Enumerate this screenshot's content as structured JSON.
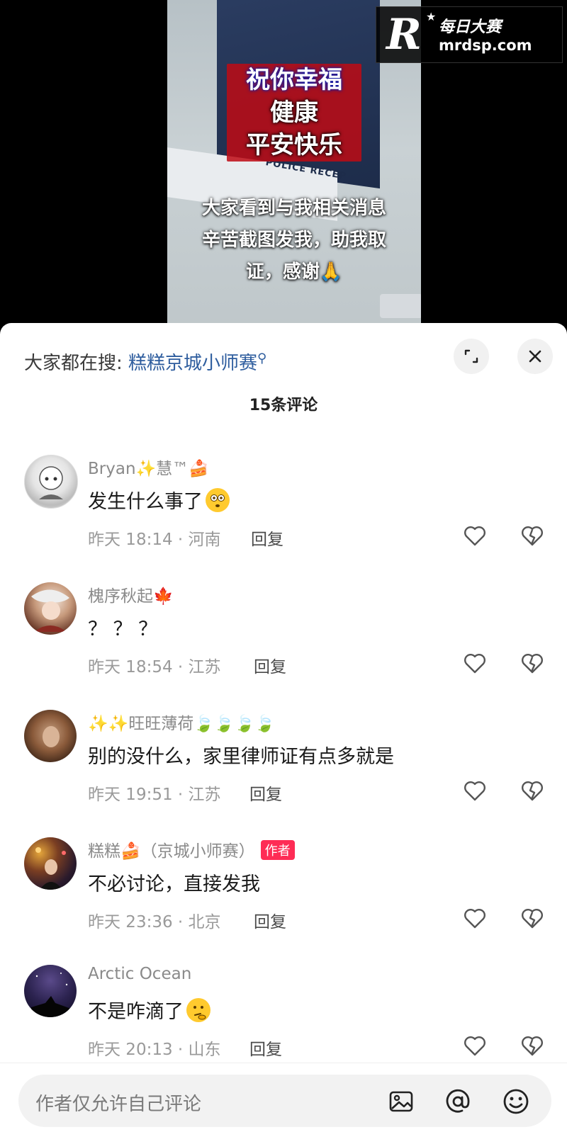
{
  "video": {
    "wish_lines": [
      "祝你幸福",
      "健康",
      "平安快乐"
    ],
    "sign_text": "POLICE RECEP",
    "caption_lines": [
      "大家看到与我相关消息",
      "辛苦截图发我，助我取",
      "证，感谢🙏"
    ],
    "watermark": {
      "logo": "R",
      "cn": "每日大赛",
      "url": "mrdsp.com"
    }
  },
  "header": {
    "search_prefix": "大家都在搜:",
    "search_term": "糕糕京城小师赛",
    "comment_count": "15条评论"
  },
  "comments": [
    {
      "name": "Bryan✨慧™🍰",
      "text": "发生什么事了",
      "time": "昨天 18:14 · 河南",
      "reply": "回复",
      "author": ""
    },
    {
      "name": "槐序秋起🍁",
      "text": "？ ？ ？",
      "time": "昨天 18:54 · 江苏",
      "reply": "回复",
      "author": ""
    },
    {
      "name": "✨✨旺旺薄荷🍃🍃🍃🍃",
      "text": "别的没什么，家里律师证有点多就是",
      "time": "昨天 19:51 · 江苏",
      "reply": "回复",
      "author": ""
    },
    {
      "name": "糕糕🍰（京城小师赛）",
      "text": "不必讨论，直接发我",
      "time": "昨天 23:36 · 北京",
      "reply": "回复",
      "author": "作者"
    },
    {
      "name": "Arctic Ocean",
      "text": "不是咋滴了",
      "time": "昨天 20:13 · 山东",
      "reply": "回复",
      "author": ""
    }
  ],
  "input": {
    "placeholder": "作者仅允许自己评论"
  },
  "colors": {
    "link": "#2e5d9e",
    "author_tag": "#fe2c55",
    "meta": "#9a9a9a"
  }
}
